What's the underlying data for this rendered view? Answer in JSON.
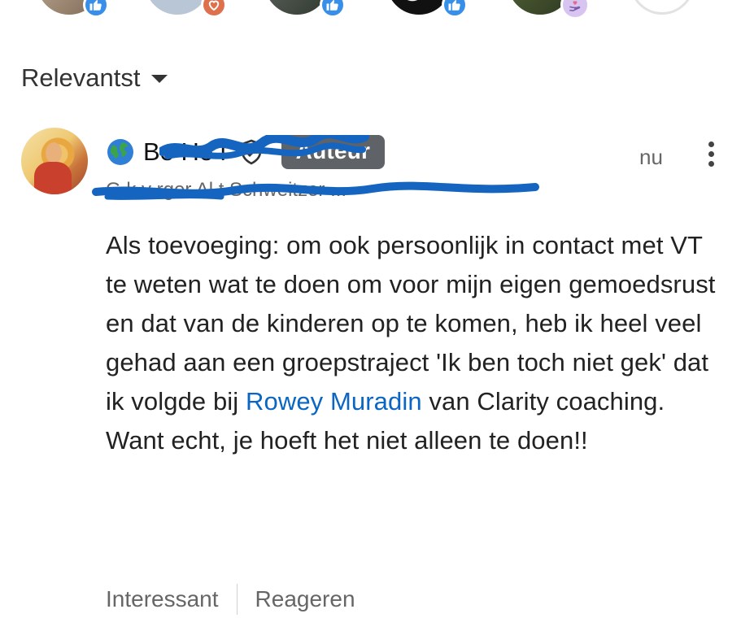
{
  "sort": {
    "label": "Relevantst"
  },
  "comment": {
    "author_name": "Be         He      l",
    "author_badge": "Auteur",
    "author_subtitle": "G        k  v      rger Al   t Schweitzer ...",
    "time": "nu",
    "text_before_mention": "Als toevoeging: om ook persoonlijk in contact met VT te weten wat te doen om voor mijn eigen gemoedsrust en dat van de kinderen op te komen, heb ik heel veel gehad aan een groepstraject 'Ik ben toch niet gek' dat ik volgde bij ",
    "mention": "Rowey Muradin",
    "text_after_mention": " van Clarity coaching. Want echt, je hoeft het niet alleen te doen!!"
  },
  "actions": {
    "interesting": "Interessant",
    "reply": "Reageren"
  },
  "colors": {
    "link": "#0a66c2",
    "badge_bg": "#5f6368",
    "like_blue": "#378fe9",
    "love_orange": "#df704d",
    "support_purple": "#d8c4f0"
  },
  "icons": [
    "like-icon",
    "love-icon",
    "support-icon",
    "globe-icon",
    "verified-icon",
    "more-icon",
    "chevron-down-icon"
  ]
}
